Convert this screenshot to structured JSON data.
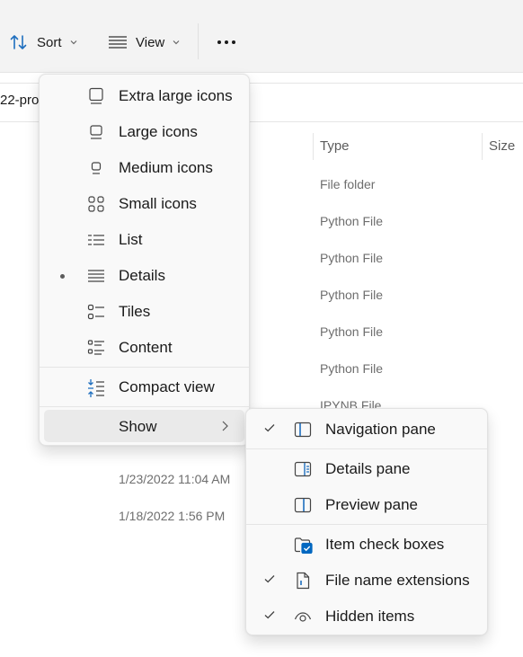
{
  "toolbar": {
    "sort_label": "Sort",
    "view_label": "View",
    "more_label": "..."
  },
  "address": {
    "text": "22-pro"
  },
  "columns": {
    "type": "Type",
    "size": "Size"
  },
  "rows": [
    {
      "type": "File folder"
    },
    {
      "type": "Python File"
    },
    {
      "type": "Python File"
    },
    {
      "type": "Python File"
    },
    {
      "type": "Python File"
    },
    {
      "type": "Python File"
    },
    {
      "type": "IPYNB File"
    }
  ],
  "dates": [
    {
      "date": "1/23/2022 11:04 AM"
    },
    {
      "date": "1/18/2022 1:56 PM"
    }
  ],
  "view_menu": {
    "items": [
      {
        "label": "Extra large icons",
        "icon": "extra-large-icons-icon"
      },
      {
        "label": "Large icons",
        "icon": "large-icons-icon"
      },
      {
        "label": "Medium icons",
        "icon": "medium-icons-icon"
      },
      {
        "label": "Small icons",
        "icon": "small-icons-icon"
      },
      {
        "label": "List",
        "icon": "list-icon"
      },
      {
        "label": "Details",
        "icon": "details-icon",
        "selected": true
      },
      {
        "label": "Tiles",
        "icon": "tiles-icon"
      },
      {
        "label": "Content",
        "icon": "content-icon"
      },
      {
        "label": "Compact view",
        "icon": "compact-view-icon"
      },
      {
        "label": "Show",
        "icon": "chevron-right-icon"
      }
    ]
  },
  "show_menu": {
    "items": [
      {
        "label": "Navigation pane",
        "icon": "navigation-pane-icon",
        "checked": true
      },
      {
        "label": "Details pane",
        "icon": "details-pane-icon",
        "checked": false
      },
      {
        "label": "Preview pane",
        "icon": "preview-pane-icon",
        "checked": false
      },
      {
        "label": "Item check boxes",
        "icon": "item-check-boxes-icon",
        "checked": false
      },
      {
        "label": "File name extensions",
        "icon": "file-name-extensions-icon",
        "checked": true
      },
      {
        "label": "Hidden items",
        "icon": "hidden-items-icon",
        "checked": true
      }
    ]
  },
  "colors": {
    "accent": "#0067c0",
    "menu_bg": "#f9f9f9",
    "toolbar_bg": "#f3f3f3"
  }
}
